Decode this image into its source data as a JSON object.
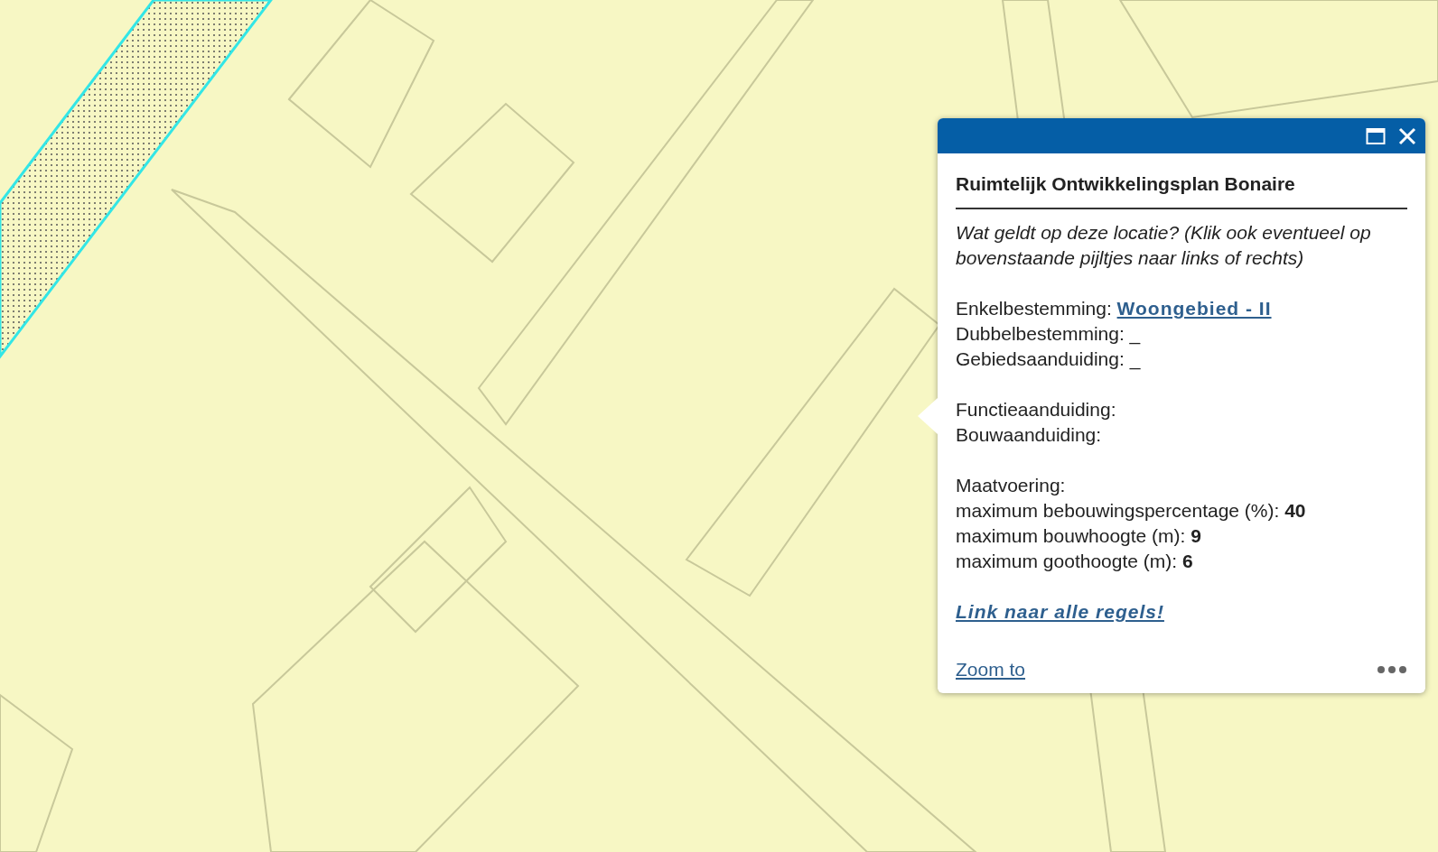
{
  "popup": {
    "title": "Ruimtelijk Ontwikkelingsplan Bonaire",
    "intro": "Wat geldt op deze locatie? (Klik ook eventueel op bovenstaande pijltjes naar links of rechts)",
    "groups": [
      [
        {
          "text": "Enkelbestemming:",
          "link": "Woongebied - II"
        },
        {
          "text": "Dubbelbestemming: _"
        },
        {
          "text": "Gebiedsaanduiding: _"
        }
      ],
      [
        {
          "text": "Functieaanduiding:"
        },
        {
          "text": "Bouwaanduiding:"
        }
      ],
      [
        {
          "text": "Maatvoering:"
        },
        {
          "text": "maximum bebouwingspercentage (%): **40**"
        },
        {
          "text": "maximum bouwhoogte (m): **9**"
        },
        {
          "text": "maximum goothoogte (m): **6**"
        }
      ]
    ],
    "rules_link": "Link naar alle regels!",
    "footer_link": "Zoom to"
  }
}
